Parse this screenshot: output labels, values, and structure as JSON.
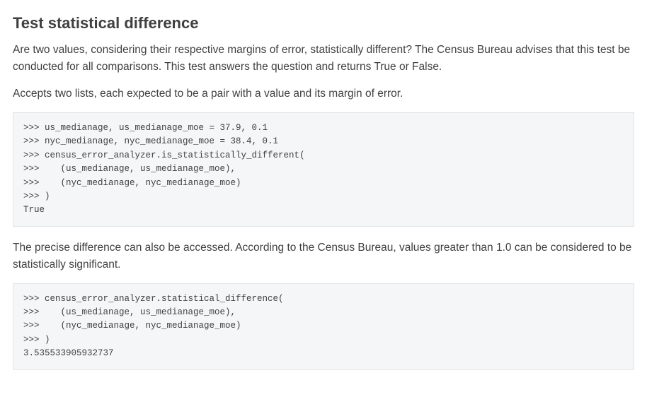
{
  "heading": "Test statistical difference",
  "para1": "Are two values, considering their respective margins of error, statistically different? The Census Bureau advises that this test be conducted for all comparisons. This test answers the question and returns True or False.",
  "para2": "Accepts two lists, each expected to be a pair with a value and its margin of error.",
  "code1": ">>> us_medianage, us_medianage_moe = 37.9, 0.1\n>>> nyc_medianage, nyc_medianage_moe = 38.4, 0.1\n>>> census_error_analyzer.is_statistically_different(\n>>>    (us_medianage, us_medianage_moe),\n>>>    (nyc_medianage, nyc_medianage_moe)\n>>> )\nTrue",
  "para3": "The precise difference can also be accessed. According to the Census Bureau, values greater than 1.0 can be considered to be statistically significant.",
  "code2": ">>> census_error_analyzer.statistical_difference(\n>>>    (us_medianage, us_medianage_moe),\n>>>    (nyc_medianage, nyc_medianage_moe)\n>>> )\n3.535533905932737"
}
